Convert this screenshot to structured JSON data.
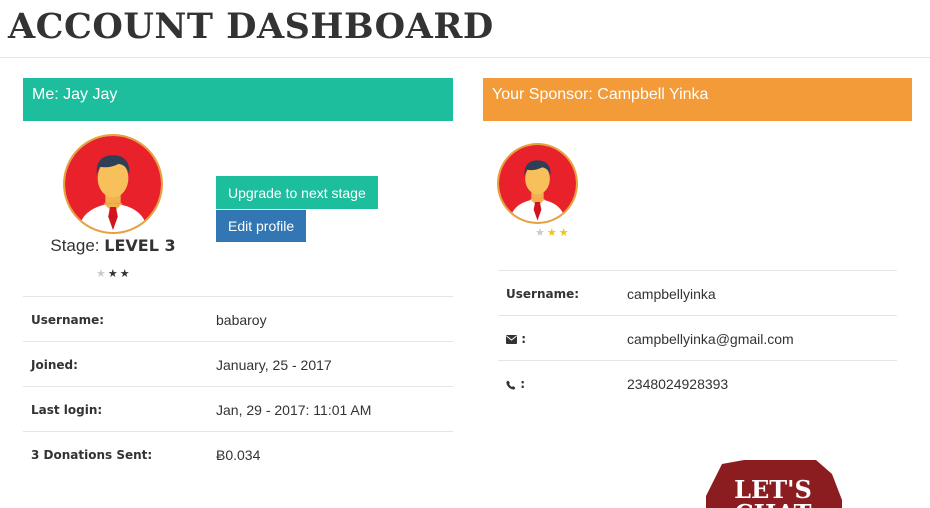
{
  "header": {
    "title": "ACCOUNT DASHBOARD"
  },
  "me": {
    "heading": "Me: Jay Jay",
    "stage_label": "Stage:",
    "stage_value": "LEVEL 3",
    "stars": {
      "filled": 2,
      "total": 3
    },
    "buttons": {
      "upgrade": "Upgrade to next stage",
      "edit": "Edit profile"
    },
    "rows": [
      {
        "label": "Username:",
        "value": "babaroy"
      },
      {
        "label": "Joined:",
        "value": "January, 25 - 2017"
      },
      {
        "label": "Last login:",
        "value": "Jan, 29 - 2017: 11:01 AM"
      },
      {
        "label": "3 Donations Sent:",
        "value": "Ƀ0.034"
      }
    ]
  },
  "sponsor": {
    "heading": "Your Sponsor: Campbell Yinka",
    "stars": {
      "filled": 2,
      "total": 3
    },
    "rows": [
      {
        "label": "Username:",
        "value": "campbellyinka"
      },
      {
        "icon": "envelope-icon",
        "label": ":",
        "value": "campbellyinka@gmail.com"
      },
      {
        "icon": "phone-icon",
        "label": ":",
        "value": "2348024928393"
      }
    ]
  },
  "badge": {
    "line1": "LET'S",
    "line2": "CHAT"
  },
  "colors": {
    "teal": "#1dbe9e",
    "orange": "#f29b38",
    "blue": "#3277b3",
    "badge": "#8b1c1f"
  }
}
